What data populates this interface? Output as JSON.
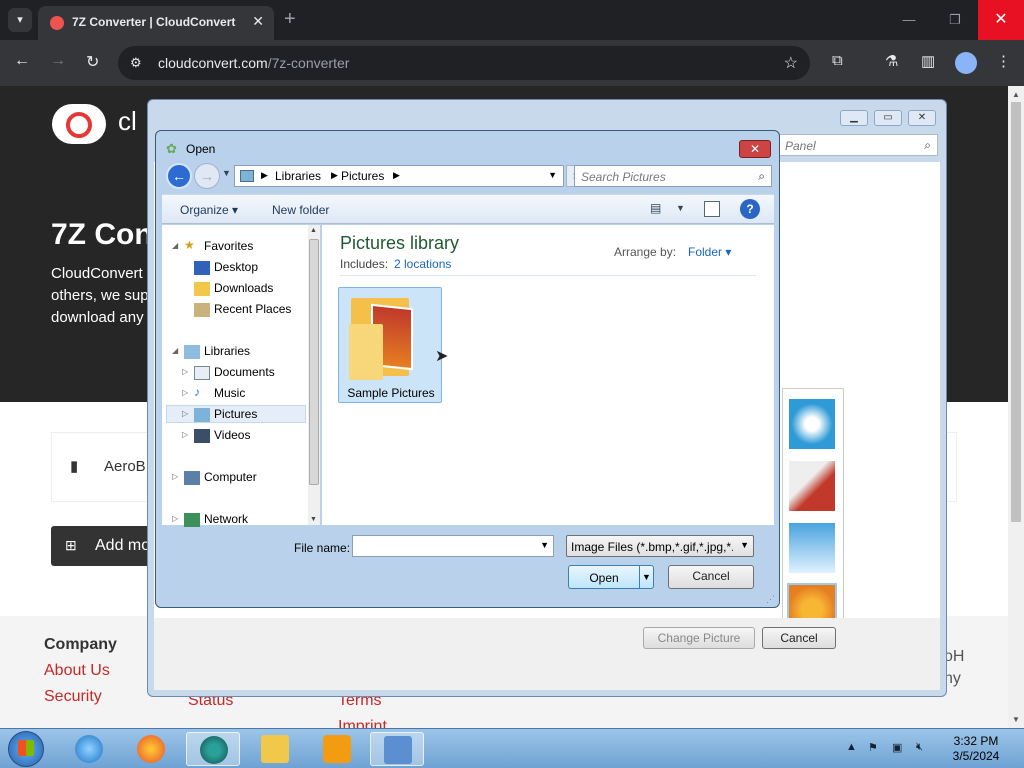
{
  "browser": {
    "tab_title": "7Z Converter | CloudConvert",
    "url_domain": "cloudconvert.com",
    "url_path": "/7z-converter"
  },
  "webpage": {
    "brand_partial": "cl",
    "hero_title": "7Z Con",
    "hero_lines": [
      "CloudConvert",
      "others, we sup",
      "download any"
    ],
    "file_name_partial": "AeroB",
    "add_more_label": "Add mo",
    "footer": {
      "company_heading": "Company",
      "links_col1": [
        "About Us",
        "Security"
      ],
      "links_col2": [
        "Status"
      ],
      "links_col3": [
        "Terms",
        "Imprint"
      ],
      "right_text": [
        "oH",
        "ny"
      ]
    }
  },
  "background_window": {
    "search_placeholder": "Panel",
    "change_picture_label": "Change Picture",
    "cancel_label": "Cancel"
  },
  "dialog": {
    "title": "Open",
    "breadcrumb": [
      "Libraries",
      "Pictures"
    ],
    "search_placeholder": "Search Pictures",
    "toolbar": {
      "organize": "Organize",
      "new_folder": "New folder"
    },
    "nav": {
      "favorites": "Favorites",
      "desktop": "Desktop",
      "downloads": "Downloads",
      "recent_places": "Recent Places",
      "libraries": "Libraries",
      "documents": "Documents",
      "music": "Music",
      "pictures": "Pictures",
      "videos": "Videos",
      "computer": "Computer",
      "network": "Network"
    },
    "library_title": "Pictures library",
    "includes_label": "Includes:",
    "includes_link": "2 locations",
    "arrange_label": "Arrange by:",
    "arrange_value": "Folder",
    "folder_name": "Sample Pictures",
    "filename_label": "File name:",
    "filename_value": "",
    "filetype": "Image Files (*.bmp,*.gif,*.jpg,*.",
    "open_label": "Open",
    "cancel_label": "Cancel"
  },
  "taskbar": {
    "time": "3:32 PM",
    "date": "3/5/2024"
  },
  "colors": {
    "chrome_dark": "#202124",
    "hero_bg": "#262626",
    "link_red": "#c62828",
    "library_green": "#1e5a32",
    "link_blue": "#1a66c2"
  }
}
